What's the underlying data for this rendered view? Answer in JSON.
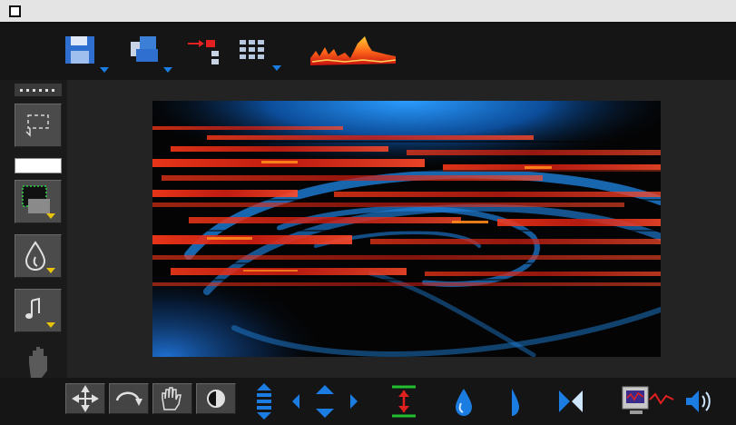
{
  "window": {
    "title": ""
  },
  "top_toolbar": {
    "icons": [
      "save-disk-icon",
      "window-stack-icon",
      "arrow-to-layers-icon",
      "grid-menu-icon",
      "spectrum-preview-icon"
    ]
  },
  "left_palette": {
    "swatch_color": "#ffffff",
    "icons": [
      "dotted-line-icon",
      "marquee-selection-icon",
      "selection-fill-icon",
      "water-drop-icon",
      "music-note-icon",
      "hand-icon",
      "waveform-icon"
    ]
  },
  "viewport": {
    "colors": {
      "blue": "#1e7fd8",
      "red": "#ff2a1a",
      "orange": "#ff8a1c",
      "background": "#040404"
    }
  },
  "bottom_toolbar": {
    "icons": [
      "move-cross-icon",
      "rotate-arrow-icon",
      "hand-grab-icon",
      "contrast-icon",
      "vertical-stretch-icon",
      "move-arrows-icon",
      "flip-vertical-icon",
      "drop-fill-icon",
      "half-drop-icon",
      "bowtie-icon",
      "monitor-signal-icon",
      "speaker-icon"
    ]
  },
  "colors": {
    "accent_yellow": "#e8c30a",
    "icon_blue": "#1b7de2",
    "icon_red": "#e22020",
    "icon_green": "#20c030"
  }
}
